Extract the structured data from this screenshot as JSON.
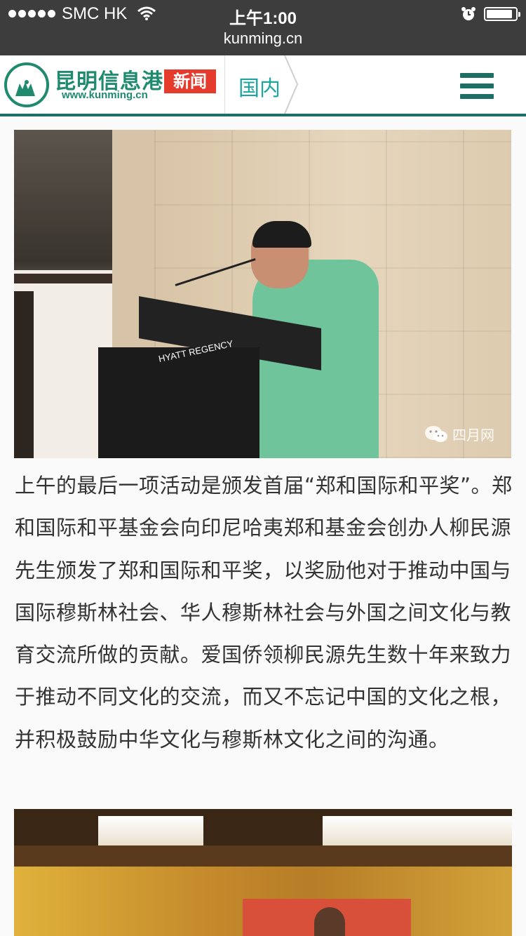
{
  "status_bar": {
    "carrier": "SMC HK",
    "time": "上午1:00",
    "url": "kunming.cn"
  },
  "header": {
    "logo_name": "昆明信息港",
    "logo_url": "www.kunming.cn",
    "logo_badge": "新闻",
    "section": "国内",
    "menu_icon": "hamburger-menu-icon"
  },
  "photo1": {
    "podium_brand": "HYATT REGENCY",
    "watermark": "四月网"
  },
  "article": {
    "paragraph": "上午的最后一项活动是颁发首届“郑和国际和平奖”。郑和国际和平基金会向印尼哈夷郑和基金会创办人柳民源先生颁发了郑和国际和平奖，以奖励他对于推动中国与国际穆斯林社会、华人穆斯林社会与外国之间文化与教育交流所做的贡献。爱国侨领柳民源先生数十年来致力于推动不同文化的交流，而又不忘记中国的文化之根，并积极鼓励中华文化与穆斯林文化之间的沟通。"
  },
  "colors": {
    "brand_green": "#1e6f63",
    "section_teal": "#1ea5a0",
    "badge_red": "#e43b2c"
  }
}
